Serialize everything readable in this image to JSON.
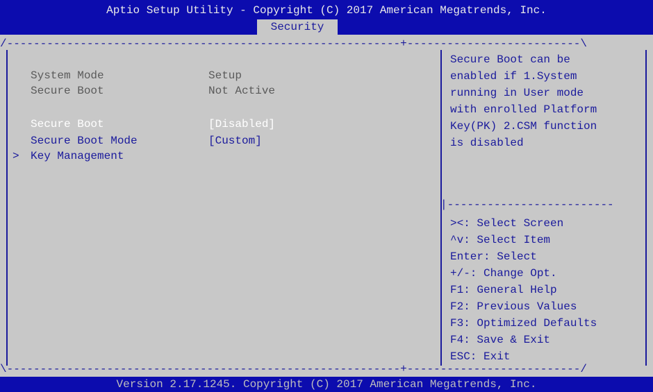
{
  "header": {
    "title": "Aptio Setup Utility - Copyright (C) 2017 American Megatrends, Inc.",
    "active_tab": "Security"
  },
  "border": {
    "top": "/-----------------------------------------------------------+--------------------------\\",
    "middle": "|-------------------------",
    "bottom": "\\-----------------------------------------------------------+--------------------------/"
  },
  "settings": [
    {
      "label": "System Mode",
      "value": "Setup",
      "state": "readonly"
    },
    {
      "label": "Secure Boot",
      "value": "Not Active",
      "state": "readonly"
    },
    {
      "label": "Secure Boot",
      "value": "[Disabled]",
      "state": "selected"
    },
    {
      "label": "Secure Boot Mode",
      "value": "[Custom]",
      "state": "editable"
    },
    {
      "label": "Key Management",
      "value": "",
      "state": "submenu",
      "marker": ">"
    }
  ],
  "help_text": [
    "Secure Boot can be",
    "enabled if 1.System",
    "running in User mode",
    "with enrolled Platform",
    "Key(PK) 2.CSM function",
    "is disabled"
  ],
  "key_help": [
    "><: Select Screen",
    "^v: Select Item",
    "Enter: Select",
    "+/-: Change Opt.",
    "F1: General Help",
    "F2: Previous Values",
    "F3: Optimized Defaults",
    "F4: Save & Exit",
    "ESC: Exit"
  ],
  "footer": {
    "version": "Version 2.17.1245. Copyright (C) 2017 American Megatrends, Inc."
  },
  "colors": {
    "background": "#c8c8c8",
    "header_bar": "#0c0cae",
    "text": "#1a1a9c",
    "selected_text": "#ffffff",
    "muted_text": "#5a5a5a"
  }
}
